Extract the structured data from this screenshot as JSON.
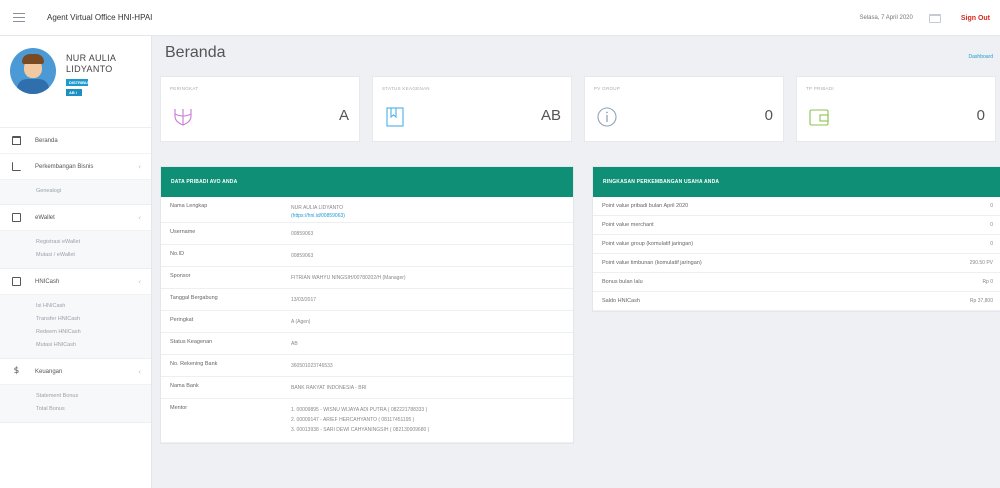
{
  "header": {
    "app_title": "Agent Virtual Office HNI-HPAI",
    "date": "Selasa, 7 April 2020",
    "sign_out": "Sign Out"
  },
  "sidebar": {
    "user_name": "NUR AULIA LIDYANTO",
    "badge_role": "DISTRIBUTOR",
    "badge_status": "AB / A",
    "nav": [
      {
        "label": "Beranda",
        "icon": "home-icon"
      },
      {
        "label": "Perkembangan Bisnis",
        "icon": "chart-icon",
        "subitems": [
          "Genealogi"
        ]
      },
      {
        "label": "eWallet",
        "icon": "wallet-icon",
        "subitems": [
          "Registrasi eWallet",
          "Mutasi / eWallet"
        ]
      },
      {
        "label": "HNICash",
        "icon": "card-icon",
        "subitems": [
          "Isi HNICash",
          "Transfer HNICash",
          "Redeem HNICash",
          "Mutasi HNICash"
        ]
      },
      {
        "label": "Keuangan",
        "icon": "dollar-icon",
        "subitems": [
          "Statement Bonus",
          "Total Bonus"
        ]
      }
    ]
  },
  "main": {
    "page_title": "Beranda",
    "dashboard_link": "Dashboard",
    "stats": [
      {
        "label": "PERINGKAT",
        "value": "A",
        "icon": "trident-icon",
        "color": "#c77bd6"
      },
      {
        "label": "STATUS KEAGENAN",
        "value": "AB",
        "icon": "bookmark-icon",
        "color": "#47b1e8"
      },
      {
        "label": "PV GROUP",
        "value": "0",
        "icon": "info-icon",
        "color": "#8fa3b5"
      },
      {
        "label": "TP PRIBADI",
        "value": "0",
        "icon": "wallet-icon",
        "color": "#8cc152"
      }
    ],
    "personal": {
      "title": "DATA PRIBADI AVO ANDA",
      "rows": [
        {
          "key": "Nama Lengkap",
          "lines": [
            "NUR AULIA LIDYANTO"
          ],
          "link": "(https://hni.id/00859063)"
        },
        {
          "key": "Username",
          "lines": [
            "00859063"
          ]
        },
        {
          "key": "No.ID",
          "lines": [
            "00859063"
          ]
        },
        {
          "key": "Sponsor",
          "lines": [
            "FITRIAN WAHYU NINGSIH/00780202/H (Manager)"
          ]
        },
        {
          "key": "Tanggal Bergabung",
          "lines": [
            "13/03/2017"
          ]
        },
        {
          "key": "Peringkat",
          "lines": [
            "A (Agen)"
          ]
        },
        {
          "key": "Status Keagenan",
          "lines": [
            "AB"
          ]
        },
        {
          "key": "No. Rekening Bank",
          "lines": [
            "360501023746533"
          ]
        },
        {
          "key": "Nama Bank",
          "lines": [
            "BANK RAKYAT INDONESIA - BRI"
          ]
        },
        {
          "key": "Mentor",
          "lines": [
            "1. 00009895 - WISNU WIJAYA ADI PUTRA ( 082221788333 )",
            "2. 00009147 - ARIEF HERCAHYANTO ( 08117451195 )",
            "3. 00013938 - SARI DEWI CAHYANINGSIH ( 082130009680 )"
          ]
        }
      ]
    },
    "summary": {
      "title": "RINGKASAN PERKEMBANGAN USAHA ANDA",
      "rows": [
        {
          "key": "Point value pribadi bulan April 2020",
          "value": "0"
        },
        {
          "key": "Point value merchant",
          "value": "0"
        },
        {
          "key": "Point value group (komulatif jaringan)",
          "value": "0"
        },
        {
          "key": "Point value timbunan (komulatif jaringan)",
          "value": "290.50 PV"
        },
        {
          "key": "Bonus bulan lalu",
          "value": "Rp 0"
        },
        {
          "key": "Saldo HNICash",
          "value": "Rp 37,800"
        }
      ]
    }
  }
}
